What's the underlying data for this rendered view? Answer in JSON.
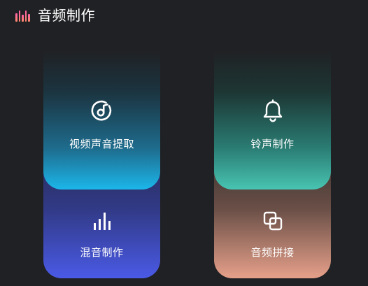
{
  "header": {
    "icon": "audio-bars-icon",
    "title": "音频制作"
  },
  "cards": {
    "extract": {
      "label": "视频声音提取",
      "icon": "music-note-disc-icon"
    },
    "ringtone": {
      "label": "铃声制作",
      "icon": "bell-icon"
    },
    "mix": {
      "label": "混音制作",
      "icon": "equalizer-bars-icon"
    },
    "splice": {
      "label": "音频拼接",
      "icon": "overlapping-squares-icon"
    }
  },
  "colors": {
    "background": "#202124",
    "extract_accent": "#1cb6ea",
    "ringtone_accent": "#48c4b2",
    "mix_accent": "#4a5ae6",
    "splice_accent": "#e6a08a",
    "header_icon": "#ff6f95"
  }
}
